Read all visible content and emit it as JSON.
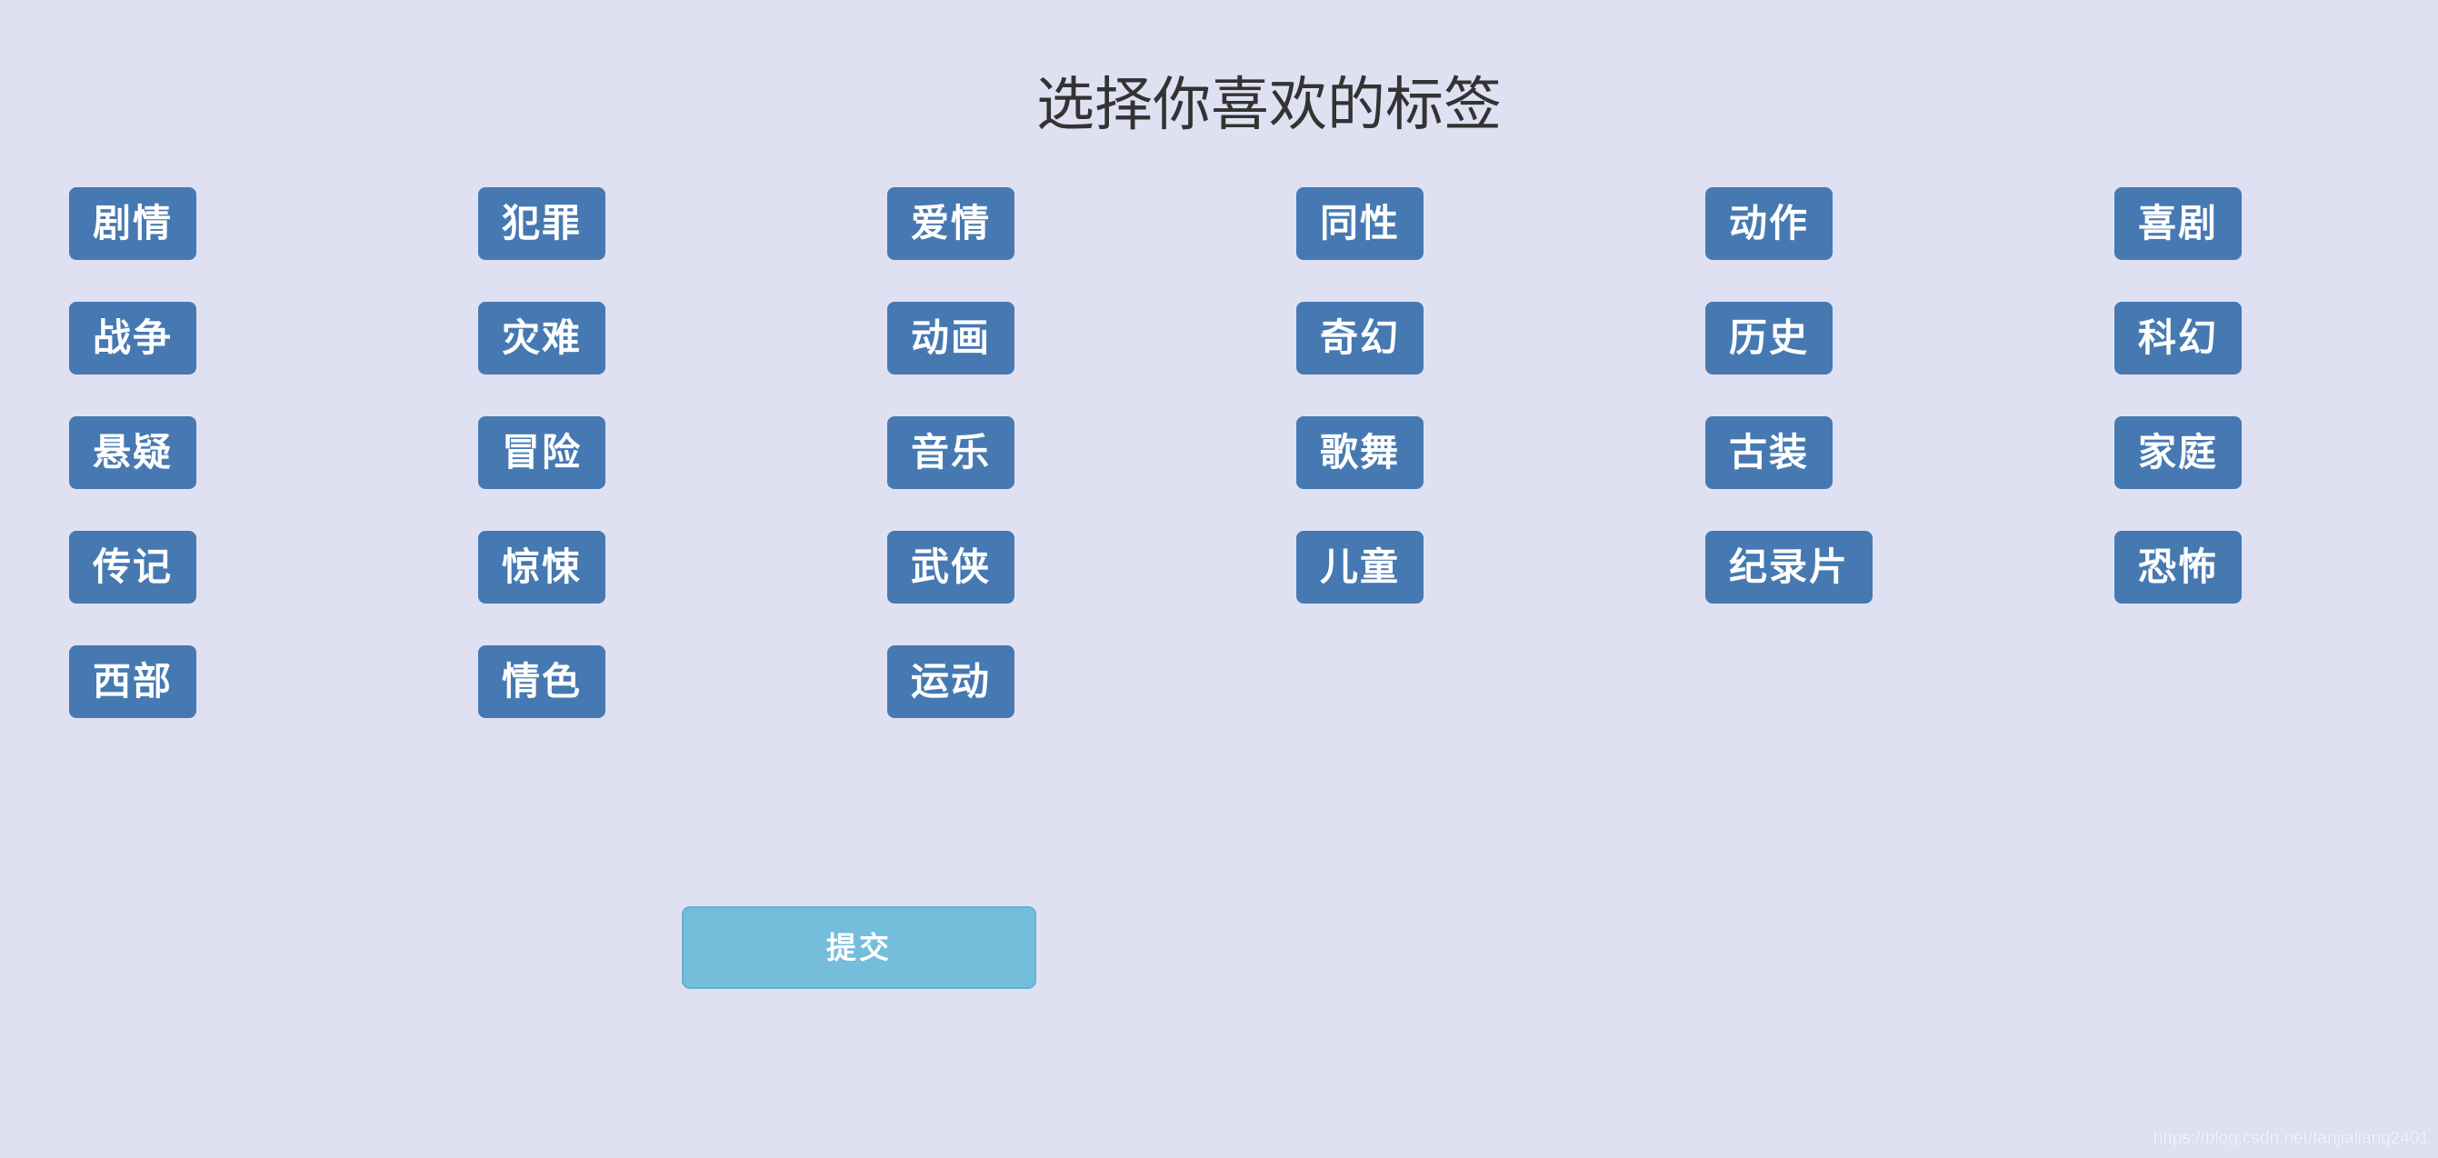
{
  "page": {
    "title": "选择你喜欢的标签",
    "background_color": "#dfe1f3"
  },
  "tags": {
    "color": "#4679b2",
    "text_color": "#ffffff",
    "items": [
      {
        "label": "剧情"
      },
      {
        "label": "犯罪"
      },
      {
        "label": "爱情"
      },
      {
        "label": "同性"
      },
      {
        "label": "动作"
      },
      {
        "label": "喜剧"
      },
      {
        "label": "战争"
      },
      {
        "label": "灾难"
      },
      {
        "label": "动画"
      },
      {
        "label": "奇幻"
      },
      {
        "label": "历史"
      },
      {
        "label": "科幻"
      },
      {
        "label": "悬疑"
      },
      {
        "label": "冒险"
      },
      {
        "label": "音乐"
      },
      {
        "label": "歌舞"
      },
      {
        "label": "古装"
      },
      {
        "label": "家庭"
      },
      {
        "label": "传记"
      },
      {
        "label": "惊悚"
      },
      {
        "label": "武侠"
      },
      {
        "label": "儿童"
      },
      {
        "label": "纪录片"
      },
      {
        "label": "恐怖"
      },
      {
        "label": "西部"
      },
      {
        "label": "情色"
      },
      {
        "label": "运动"
      }
    ]
  },
  "submit": {
    "label": "提交",
    "color": "#74bddb"
  },
  "watermark": {
    "text": "https://blog.csdn.net/fanjialiang2401"
  }
}
